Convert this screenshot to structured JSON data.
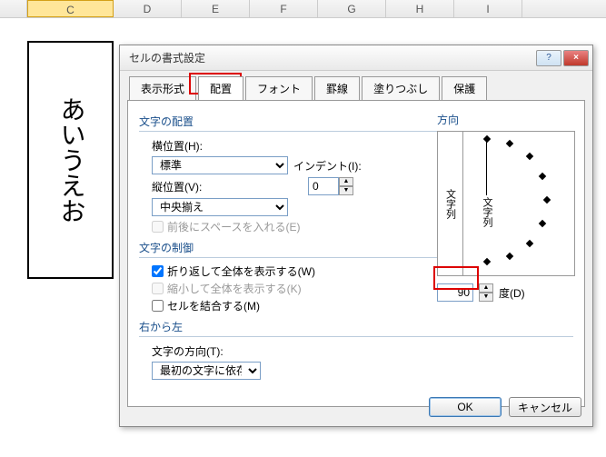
{
  "columns": [
    "C",
    "D",
    "E",
    "F",
    "G",
    "H",
    "I"
  ],
  "cell_text": "あいうえお",
  "dialog": {
    "title": "セルの書式設定",
    "tabs": [
      "表示形式",
      "配置",
      "フォント",
      "罫線",
      "塗りつぶし",
      "保護"
    ],
    "active_tab": 1,
    "align": {
      "section": "文字の配置",
      "horiz_label": "横位置(H):",
      "horiz_value": "標準",
      "indent_label": "インデント(I):",
      "indent_value": "0",
      "vert_label": "縦位置(V):",
      "vert_value": "中央揃え",
      "justify_label": "前後にスペースを入れる(E)"
    },
    "control": {
      "section": "文字の制御",
      "wrap": "折り返して全体を表示する(W)",
      "shrink": "縮小して全体を表示する(K)",
      "merge": "セルを結合する(M)"
    },
    "rtl": {
      "section": "右から左",
      "dir_label": "文字の方向(T):",
      "dir_value": "最初の文字に依存"
    },
    "orient": {
      "section": "方向",
      "vlabel": "文字列",
      "vlabel2": "文字列",
      "degree": "90",
      "degree_label": "度(D)"
    },
    "ok": "OK",
    "cancel": "キャンセル"
  }
}
